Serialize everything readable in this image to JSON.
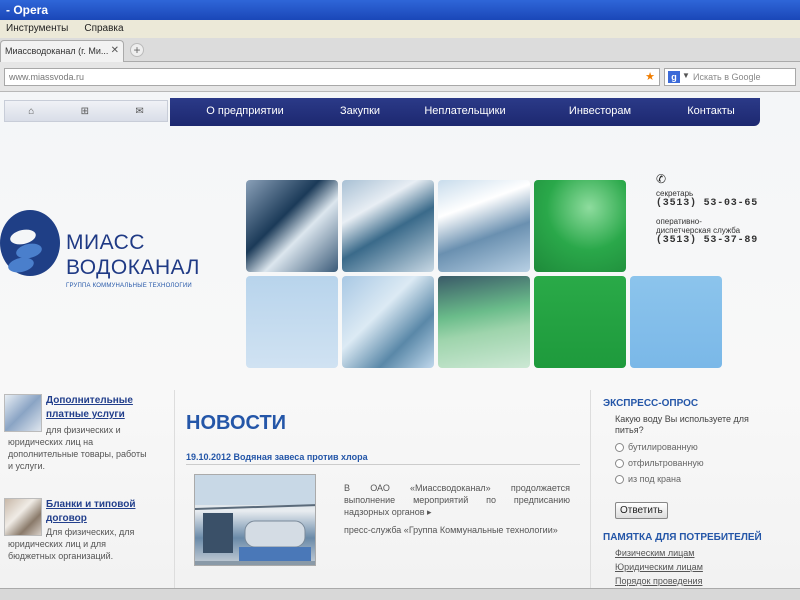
{
  "window": {
    "title": "- Opera"
  },
  "menu": {
    "items": [
      "Инструменты",
      "Справка"
    ]
  },
  "tabs": [
    {
      "label": "Миассводоканал (г. Ми..."
    }
  ],
  "address": {
    "url": "www.miassvoda.ru",
    "search_placeholder": "Искать в Google"
  },
  "nav": {
    "items": [
      "О предприятии",
      "Закупки",
      "Неплательщики",
      "Инвесторам",
      "Контакты"
    ]
  },
  "logo": {
    "line1": "МИАСС",
    "line2": "ВОДОКАНАЛ",
    "tagline": "ГРУППА КОММУНАЛЬНЫЕ ТЕХНОЛОГИИ"
  },
  "contacts": {
    "secretary_label": "секретарь",
    "secretary_phone": "(3513) 53-03-65",
    "dispatch_label_1": "оперативно-",
    "dispatch_label_2": "диспетчерская служба",
    "dispatch_phone": "(3513) 53-37-89"
  },
  "services": [
    {
      "title_1": "Дополнительные",
      "title_2": "платные услуги",
      "text_1": "для физических и",
      "text_2": "юридических лиц на",
      "text_3": "дополнительные товары, работы",
      "text_4": "и услуги."
    },
    {
      "title_1": "Бланки и типовой",
      "title_2": "договор",
      "text_1": "Для физических, для",
      "text_2": "юридических лиц и для",
      "text_3": "бюджетных организаций."
    }
  ],
  "news": {
    "heading": "НОВОСТИ",
    "date_title": "19.10.2012 Водяная завеса против хлора",
    "body": "В ОАО «Миассводоканал» продолжается выполнение мероприятий по предписанию надзорных органов ▸",
    "press": "пресс-служба «Группа Коммунальные технологии»"
  },
  "poll": {
    "title": "ЭКСПРЕСС-ОПРОС",
    "question": "Какую воду Вы используете для питья?",
    "options": [
      "бутилированную",
      "отфильтрованную",
      "из под крана"
    ],
    "button": "Ответить"
  },
  "memo": {
    "title": "ПАМЯТКА ДЛЯ ПОТРЕБИТЕЛЕЙ",
    "links": [
      "Физическим лицам",
      "Юридическим лицам",
      "Порядок проведения"
    ]
  },
  "colors": {
    "brand_blue": "#1f3f86",
    "nav_bg": "#1d2870",
    "link_blue": "#2456a8",
    "green": "#2aa84a"
  }
}
